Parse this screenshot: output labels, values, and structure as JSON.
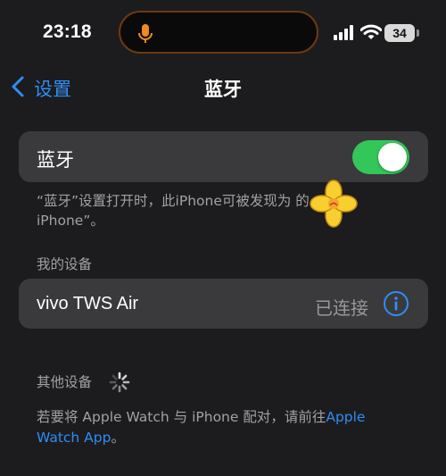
{
  "status_bar": {
    "time": "23:18",
    "battery_level": "34",
    "icons": [
      "microphone-icon",
      "cellular-signal-icon",
      "wifi-icon",
      "battery-icon"
    ],
    "mic_color": "#f08a1c"
  },
  "nav": {
    "back_label": "设置",
    "title": "蓝牙"
  },
  "bluetooth": {
    "label": "蓝牙",
    "enabled": true,
    "toggle_color": "#33c759",
    "footnote": "“蓝牙”设置打开时，此iPhone可被发现为 的iPhone”。"
  },
  "my_devices": {
    "header": "我的设备",
    "items": [
      {
        "name": "vivo TWS Air",
        "status": "已连接",
        "icon": "info-icon"
      }
    ]
  },
  "other_devices": {
    "header": "其他设备",
    "loading_icon": "spinner-icon"
  },
  "pairing_hint": {
    "text": "若要将 Apple Watch 与 iPhone 配对，请前往",
    "link": "Apple Watch App",
    "suffix": "。"
  },
  "colors": {
    "accent": "#2f8df4",
    "background": "#1c1c1e",
    "card": "#3a3a3c",
    "secondary_text": "#a1a1a6"
  }
}
